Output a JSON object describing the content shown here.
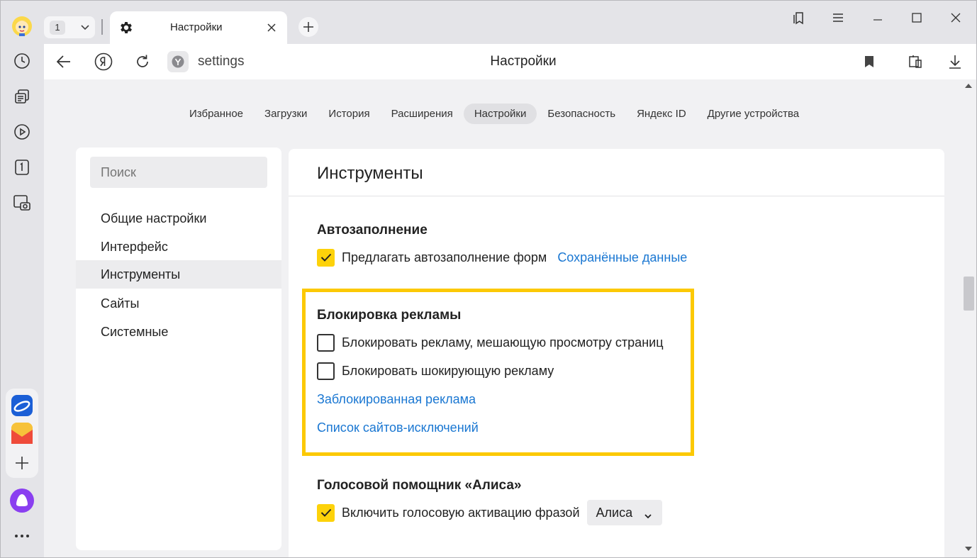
{
  "tabstrip": {
    "tab_count": "1",
    "active_tab_title": "Настройки"
  },
  "toolbar": {
    "url": "settings",
    "page_title": "Настройки"
  },
  "nav": {
    "tabs": [
      {
        "label": "Избранное"
      },
      {
        "label": "Загрузки"
      },
      {
        "label": "История"
      },
      {
        "label": "Расширения"
      },
      {
        "label": "Настройки",
        "active": true
      },
      {
        "label": "Безопасность"
      },
      {
        "label": "Яндекс ID"
      },
      {
        "label": "Другие устройства"
      }
    ]
  },
  "sidebar": {
    "search_placeholder": "Поиск",
    "items": [
      {
        "label": "Общие настройки"
      },
      {
        "label": "Интерфейс"
      },
      {
        "label": "Инструменты",
        "active": true
      },
      {
        "label": "Сайты"
      },
      {
        "label": "Системные"
      }
    ]
  },
  "panel": {
    "title": "Инструменты",
    "autofill": {
      "heading": "Автозаполнение",
      "option_label": "Предлагать автозаполнение форм",
      "option_checked": true,
      "link": "Сохранённые данные"
    },
    "adblock": {
      "heading": "Блокировка рекламы",
      "option1_label": "Блокировать рекламу, мешающую просмотру страниц",
      "option1_checked": false,
      "option2_label": "Блокировать шокирующую рекламу",
      "option2_checked": false,
      "link1": "Заблокированная реклама",
      "link2": "Список сайтов-исключений"
    },
    "alice": {
      "heading": "Голосовой помощник «Алиса»",
      "option_label": "Включить голосовую активацию фразой",
      "option_checked": true,
      "select_value": "Алиса"
    }
  },
  "colors": {
    "accent_yellow": "#fdd20a",
    "highlight_border": "#fcc904",
    "link_blue": "#1a77d2"
  }
}
